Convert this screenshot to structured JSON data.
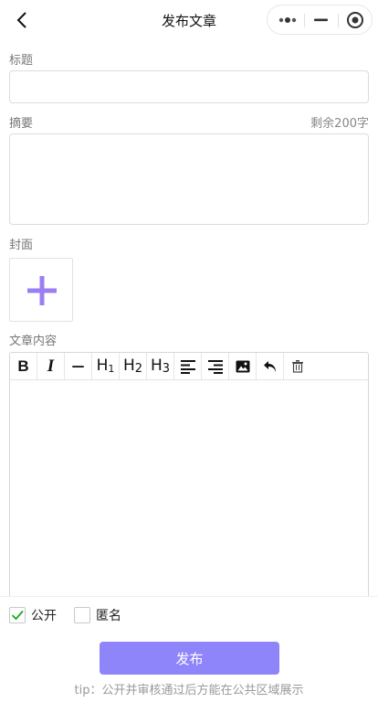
{
  "header": {
    "title": "发布文章",
    "back_icon": "back-icon",
    "capsule_icons": [
      "more-icon",
      "minimize-icon",
      "close-target-icon"
    ]
  },
  "form": {
    "title_label": "标题",
    "title_value": "",
    "summary_label": "摘要",
    "summary_counter": "剩余200字",
    "summary_value": "",
    "cover_label": "封面",
    "cover_add_icon": "plus-icon",
    "content_label": "文章内容"
  },
  "toolbar": {
    "bold": "B",
    "italic": "I",
    "hr": "—",
    "h1_main": "H",
    "h1_sub": "1",
    "h2_main": "H",
    "h2_sub": "2",
    "h3_main": "H",
    "h3_sub": "3",
    "icons": [
      "align-left-icon",
      "align-right-icon",
      "image-icon",
      "undo-icon",
      "trash-icon"
    ]
  },
  "options": {
    "public_label": "公开",
    "public_checked": true,
    "anonymous_label": "匿名",
    "anonymous_checked": false
  },
  "actions": {
    "publish_label": "发布",
    "tip": "tip：公开并审核通过后方能在公共区域展示"
  },
  "colors": {
    "accent": "#8f85fb",
    "plus": "#9b7ff2",
    "check": "#1aad19"
  }
}
